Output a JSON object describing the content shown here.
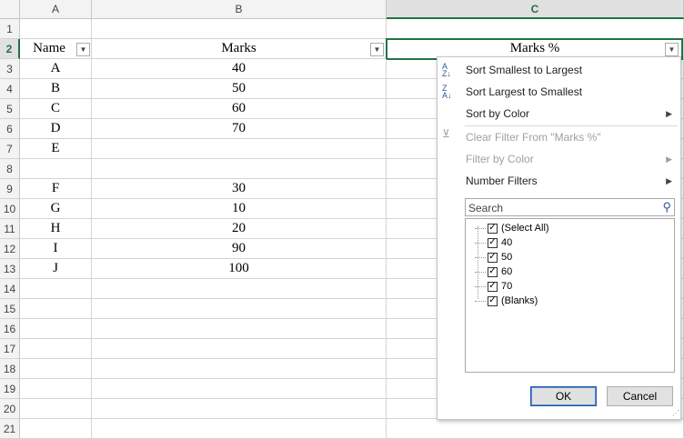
{
  "columns": [
    {
      "label": "A"
    },
    {
      "label": "B"
    },
    {
      "label": "C"
    }
  ],
  "rows": [
    "1",
    "2",
    "3",
    "4",
    "5",
    "6",
    "7",
    "8",
    "9",
    "10",
    "11",
    "12",
    "13",
    "14",
    "15",
    "16",
    "17",
    "18",
    "19",
    "20",
    "21"
  ],
  "headers": {
    "name": "Name",
    "marks": "Marks",
    "marks_pct": "Marks %"
  },
  "data": [
    {
      "name": "A",
      "marks": "40"
    },
    {
      "name": "B",
      "marks": "50"
    },
    {
      "name": "C",
      "marks": "60"
    },
    {
      "name": "D",
      "marks": "70"
    },
    {
      "name": "E",
      "marks": ""
    },
    {
      "name": "",
      "marks": ""
    },
    {
      "name": "F",
      "marks": "30"
    },
    {
      "name": "G",
      "marks": "10"
    },
    {
      "name": "H",
      "marks": "20"
    },
    {
      "name": "I",
      "marks": "90"
    },
    {
      "name": "J",
      "marks": "100"
    }
  ],
  "filter_menu": {
    "sort_asc": "Sort Smallest to Largest",
    "sort_desc": "Sort Largest to Smallest",
    "sort_by_color": "Sort by Color",
    "clear_filter": "Clear Filter From \"Marks %\"",
    "filter_by_color": "Filter by Color",
    "number_filters": "Number Filters",
    "search_placeholder": "Search",
    "items": [
      {
        "label": "(Select All)",
        "checked": true
      },
      {
        "label": "40",
        "checked": true
      },
      {
        "label": "50",
        "checked": true
      },
      {
        "label": "60",
        "checked": true
      },
      {
        "label": "70",
        "checked": true
      },
      {
        "label": "(Blanks)",
        "checked": true
      }
    ],
    "ok_label": "OK",
    "cancel_label": "Cancel"
  },
  "colors": {
    "excel_green": "#217346",
    "icon_blue": "#2b579a"
  }
}
